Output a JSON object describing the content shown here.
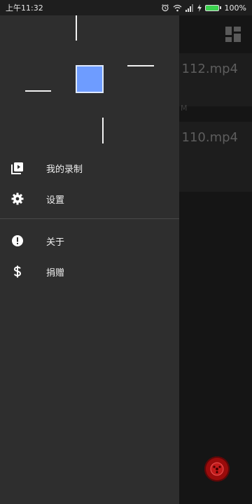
{
  "status_bar": {
    "time": "上午11:32",
    "battery_percent": "100%",
    "battery_level": 1.0,
    "icons": [
      "alarm-icon",
      "wifi-icon",
      "signal-icon",
      "charging-icon",
      "battery-icon"
    ]
  },
  "background_list": {
    "items": [
      {
        "name": "112.mp4"
      },
      {
        "name": "110.mp4"
      }
    ],
    "meta_fragment": "M"
  },
  "drawer": {
    "logo": "app-logo",
    "menu": [
      {
        "label": "我的录制",
        "icon": "video-library-icon"
      },
      {
        "label": "设置",
        "icon": "gear-icon"
      },
      {
        "label": "关于",
        "icon": "info-alert-icon"
      },
      {
        "label": "捐赠",
        "icon": "dollar-icon"
      }
    ]
  },
  "colors": {
    "drawer_bg": "#2e2e2e",
    "logo_accent": "#6e9cff",
    "fab": "#9a0b0b"
  }
}
